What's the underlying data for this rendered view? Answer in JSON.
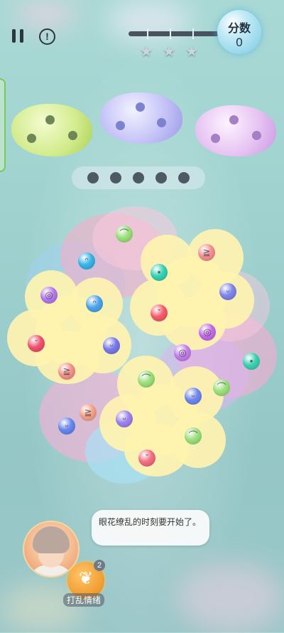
{
  "hud": {
    "score_label": "分数",
    "score_value": "0",
    "stars": [
      "★",
      "★",
      "★"
    ],
    "info_glyph": "!"
  },
  "trays": [
    {
      "color": "#c9e67d",
      "dots": 3
    },
    {
      "color": "#b7b5f1",
      "dots": 3
    },
    {
      "color": "#deb5ee",
      "dots": 3
    }
  ],
  "slots": {
    "count": 5
  },
  "faces": [
    {
      "color": "#9adf7a",
      "glyph": "⌒"
    },
    {
      "color": "#38b3e6",
      "glyph": "ᵔ"
    },
    {
      "color": "#f58f91",
      "glyph": "≧"
    },
    {
      "color": "#34d1b3",
      "glyph": "•"
    },
    {
      "color": "#7d84ec",
      "glyph": "ᵕ"
    },
    {
      "color": "#f35c6b",
      "glyph": "ˇ"
    },
    {
      "color": "#c46ae8",
      "glyph": "◎"
    },
    {
      "color": "#b478ec",
      "glyph": "◎"
    },
    {
      "color": "#4aa4ea",
      "glyph": "ᵔ"
    },
    {
      "color": "#f0506d",
      "glyph": "ˇ"
    },
    {
      "color": "#7778ea",
      "glyph": "ᵕ"
    },
    {
      "color": "#f49188",
      "glyph": "≧"
    },
    {
      "color": "#c27ee8",
      "glyph": "◎"
    },
    {
      "color": "#3bd0b0",
      "glyph": "•"
    },
    {
      "color": "#9adf7a",
      "glyph": "⌒"
    },
    {
      "color": "#6f86ee",
      "glyph": "ᵕ"
    },
    {
      "color": "#9adf7a",
      "glyph": "⌒"
    },
    {
      "color": "#9a83ec",
      "glyph": "ᵕ"
    },
    {
      "color": "#9adf7a",
      "glyph": "⌒"
    },
    {
      "color": "#f26d80",
      "glyph": "ˇ"
    },
    {
      "color": "#6786ee",
      "glyph": "ᵕ"
    },
    {
      "color": "#f5a08a",
      "glyph": "≧"
    }
  ],
  "dialog": {
    "text": "眼花缭乱的时刻要开始了。"
  },
  "skill": {
    "label": "打乱情绪",
    "count": "2",
    "icon": "shuffle-emotion-icon"
  }
}
